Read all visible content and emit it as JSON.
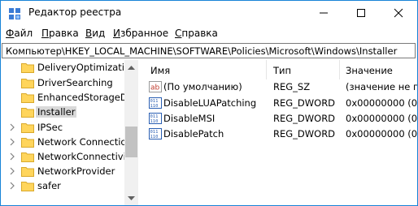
{
  "window": {
    "title": "Редактор реестра",
    "icon": "regedit-icon",
    "controls": [
      "minimize-icon",
      "maximize-icon",
      "close-icon"
    ]
  },
  "menu": [
    {
      "label": "Файл",
      "access": "Ф",
      "rest": "айл"
    },
    {
      "label": "Правка",
      "access": "П",
      "rest": "равка"
    },
    {
      "label": "Вид",
      "access": "В",
      "rest": "ид"
    },
    {
      "label": "Избранное",
      "access": "И",
      "rest": "збранное"
    },
    {
      "label": "Справка",
      "access": "С",
      "rest": "правка"
    }
  ],
  "address": {
    "path": "Компьютер\\HKEY_LOCAL_MACHINE\\SOFTWARE\\Policies\\Microsoft\\Windows\\Installer"
  },
  "tree": {
    "items": [
      {
        "label": "DeliveryOptimization",
        "expandable": false
      },
      {
        "label": "DriverSearching",
        "expandable": false
      },
      {
        "label": "EnhancedStorageDe",
        "expandable": false
      },
      {
        "label": "Installer",
        "expandable": false,
        "selected": true
      },
      {
        "label": "IPSec",
        "expandable": true
      },
      {
        "label": "Network Connection",
        "expandable": true
      },
      {
        "label": "NetworkConnectivit",
        "expandable": true
      },
      {
        "label": "NetworkProvider",
        "expandable": true
      },
      {
        "label": "safer",
        "expandable": true
      }
    ]
  },
  "list": {
    "columns": [
      "Имя",
      "Тип",
      "Значение"
    ],
    "rows": [
      {
        "icon": "string-value-icon",
        "name": "(По умолчанию)",
        "type": "REG_SZ",
        "value": "(значение не пр"
      },
      {
        "icon": "binary-value-icon",
        "name": "DisableLUAPatching",
        "type": "REG_DWORD",
        "value": "0x00000000 (0)"
      },
      {
        "icon": "binary-value-icon",
        "name": "DisableMSI",
        "type": "REG_DWORD",
        "value": "0x00000000 (0)"
      },
      {
        "icon": "binary-value-icon",
        "name": "DisablePatch",
        "type": "REG_DWORD",
        "value": "0x00000000 (0)"
      }
    ]
  },
  "colors": {
    "window_border": "#1883d7",
    "folder": "#ffd55c",
    "selection": "#d9d9d9",
    "value_icon_blue": "#2a5fb3",
    "string_icon_red": "#c0392b"
  }
}
